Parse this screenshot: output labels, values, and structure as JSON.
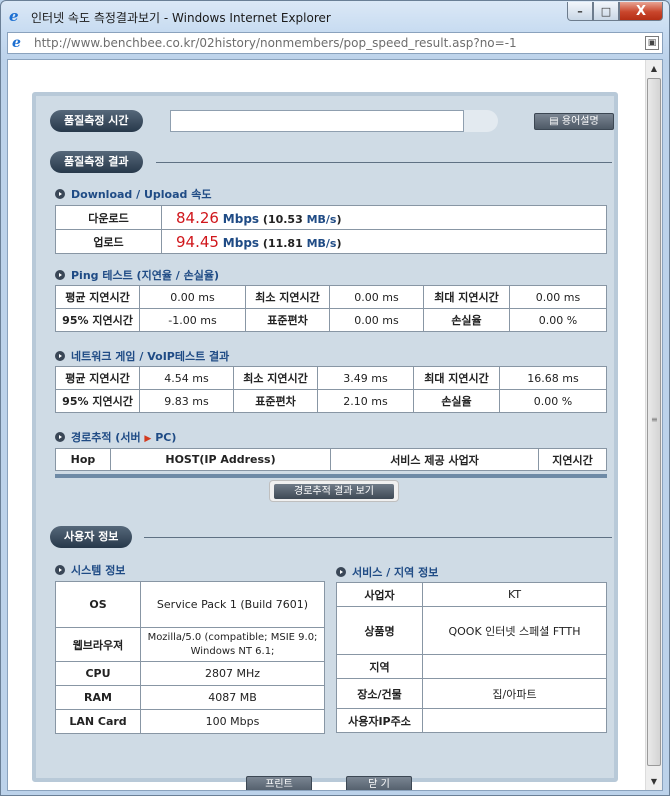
{
  "window": {
    "title": "인터넷 속도 측정결과보기 - Windows Internet Explorer",
    "url": "http://www.benchbee.co.kr/02history/nonmembers/pop_speed_result.asp?no=-1",
    "minimize_glyph": "–",
    "maximize_glyph": "□",
    "close_glyph": "X"
  },
  "measure_time": {
    "label": "품질측정 시간",
    "value": "",
    "glossary_button": "용어설명"
  },
  "result": {
    "label": "품질측정 결과",
    "speed_heading": "Download / Upload 속도",
    "download": {
      "label": "다운로드",
      "mbps": "84.26",
      "unit": "Mbps",
      "mb": "10.53",
      "mb_unit": "MB/s"
    },
    "upload": {
      "label": "업로드",
      "mbps": "94.45",
      "unit": "Mbps",
      "mb": "11.81",
      "mb_unit": "MB/s"
    },
    "ping_heading": "Ping 테스트 (지연율 / 손실율)",
    "ping": {
      "avg_label": "평균 지연시간",
      "avg": "0.00 ms",
      "min_label": "최소 지연시간",
      "min": "0.00 ms",
      "max_label": "최대 지연시간",
      "max": "0.00 ms",
      "p95_label": "95% 지연시간",
      "p95": "-1.00 ms",
      "std_label": "표준편차",
      "std": "0.00 ms",
      "loss_label": "손실율",
      "loss": "0.00 %"
    },
    "game_heading": "네트워크 게임 / VoIP테스트 결과",
    "game": {
      "avg_label": "평균 지연시간",
      "avg": "4.54 ms",
      "min_label": "최소 지연시간",
      "min": "3.49 ms",
      "max_label": "최대 지연시간",
      "max": "16.68 ms",
      "p95_label": "95% 지연시간",
      "p95": "9.83 ms",
      "std_label": "표준편차",
      "std": "2.10 ms",
      "loss_label": "손실율",
      "loss": "0.00 %"
    },
    "route_heading_prefix": "경로추적 (서버",
    "route_heading_suffix": "PC)",
    "route_columns": [
      "Hop",
      "HOST(IP Address)",
      "서비스 제공 사업자",
      "지연시간"
    ],
    "route_button": "경로추적 결과 보기"
  },
  "user": {
    "label": "사용자 정보",
    "system_heading": "시스템 정보",
    "system": [
      {
        "label": "OS",
        "value": "Service Pack 1 (Build 7601)"
      },
      {
        "label": "웹브라우져",
        "value": "Mozilla/5.0 (compatible; MSIE 9.0; Windows NT 6.1;"
      },
      {
        "label": "CPU",
        "value": "2807 MHz"
      },
      {
        "label": "RAM",
        "value": "4087 MB"
      },
      {
        "label": "LAN Card",
        "value": "100 Mbps"
      }
    ],
    "service_heading": "서비스 / 지역 정보",
    "service": [
      {
        "label": "사업자",
        "value": "KT"
      },
      {
        "label": "상품명",
        "value": "QOOK 인터넷 스페셜 FTTH"
      },
      {
        "label": "지역",
        "value": ""
      },
      {
        "label": "장소/건물",
        "value": "집/아파트"
      },
      {
        "label": "사용자IP주소",
        "value": ""
      }
    ]
  },
  "bottom_buttons": {
    "print": "프린트",
    "close": "닫 기"
  },
  "colors": {
    "speed_value": "#d0161b",
    "heading": "#1f4b85",
    "panel": "#cfdbe5"
  }
}
